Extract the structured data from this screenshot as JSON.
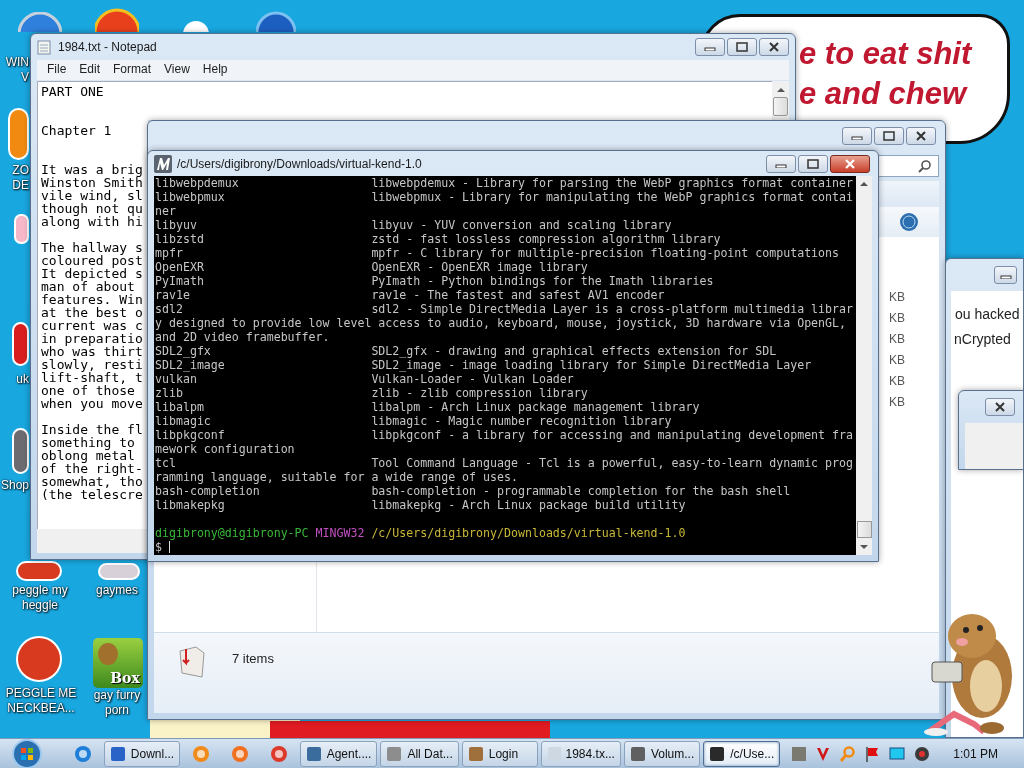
{
  "desktop_icons": [
    {
      "lines": [
        "WIN",
        "V"
      ]
    },
    {
      "lines": [
        "ZO",
        "DE"
      ]
    },
    {
      "lines": [
        "uk"
      ]
    },
    {
      "lines": [
        "Shop"
      ]
    },
    {
      "lines": [
        "peggle my",
        "heggle"
      ]
    },
    {
      "lines": [
        "PEGGLE ME",
        "NECKBEA..."
      ]
    },
    {
      "lines": [
        "gaymes"
      ]
    },
    {
      "lines": [
        "gay furry",
        "porn"
      ],
      "badge": "Box"
    }
  ],
  "speech_bubble": {
    "lines": [
      "e to eat shit",
      "e and chew"
    ]
  },
  "notepad": {
    "title": "1984.txt - Notepad",
    "menu": [
      "File",
      "Edit",
      "Format",
      "View",
      "Help"
    ],
    "lines": [
      {
        "kind": "text",
        "text": "PART ONE"
      },
      {
        "kind": "blank"
      },
      {
        "kind": "blank"
      },
      {
        "kind": "text",
        "text": "Chapter 1"
      },
      {
        "kind": "blank"
      },
      {
        "kind": "blank"
      },
      {
        "kind": "text",
        "text": "It was a brig"
      },
      {
        "kind": "text",
        "text": "Winston Smith"
      },
      {
        "kind": "text",
        "text": "vile wind, sl"
      },
      {
        "kind": "text",
        "text": "though not qu"
      },
      {
        "kind": "text",
        "text": "along with hi"
      },
      {
        "kind": "blank"
      },
      {
        "kind": "text",
        "text": "The hallway s"
      },
      {
        "kind": "text",
        "text": "coloured post"
      },
      {
        "kind": "text",
        "text": "It depicted s"
      },
      {
        "kind": "text",
        "text": "man of about"
      },
      {
        "kind": "text",
        "text": "features. Win"
      },
      {
        "kind": "text",
        "text": "at the best o"
      },
      {
        "kind": "text",
        "text": "current was c"
      },
      {
        "kind": "text",
        "text": "in preparatio"
      },
      {
        "kind": "text",
        "text": "who was thirt"
      },
      {
        "kind": "text",
        "text": "slowly, resti"
      },
      {
        "kind": "text",
        "text": "lift-shaft, t"
      },
      {
        "kind": "text",
        "text": "one of those"
      },
      {
        "kind": "text",
        "text": "when you move"
      },
      {
        "kind": "blank"
      },
      {
        "kind": "text",
        "text": "Inside the fl"
      },
      {
        "kind": "text",
        "text": "something to"
      },
      {
        "kind": "text",
        "text": "oblong metal"
      },
      {
        "kind": "text",
        "text": "of the right-"
      },
      {
        "kind": "text",
        "text": "somewhat, tho"
      },
      {
        "kind": "text",
        "text": "(the telescre"
      }
    ]
  },
  "explorer": {
    "sizes": [
      "KB",
      "KB",
      "KB",
      "KB",
      "KB",
      "KB"
    ],
    "status": "7 items"
  },
  "side_window": {
    "lines": [
      "ou hacked",
      "nCrypted"
    ]
  },
  "terminal": {
    "title": "/c/Users/digibrony/Downloads/virtual-kend-1.0",
    "lines": [
      {
        "kind": "entry",
        "name": "libwebpdemux",
        "desc": "libwebpdemux - Library for parsing the WebP graphics format container"
      },
      {
        "kind": "entry",
        "name": "libwebpmux",
        "desc": "libwebpmux - Library for manipulating the WebP graphics format contai"
      },
      {
        "kind": "wrap",
        "text": "ner"
      },
      {
        "kind": "entry",
        "name": "libyuv",
        "desc": "libyuv - YUV conversion and scaling library"
      },
      {
        "kind": "entry",
        "name": "libzstd",
        "desc": "zstd - fast lossless compression algorithm library"
      },
      {
        "kind": "entry",
        "name": "mpfr",
        "desc": "mpfr - C library for multiple-precision floating-point computations"
      },
      {
        "kind": "entry",
        "name": "OpenEXR",
        "desc": "OpenEXR - OpenEXR image library"
      },
      {
        "kind": "entry",
        "name": "PyImath",
        "desc": "PyImath - Python bindings for the Imath libraries"
      },
      {
        "kind": "entry",
        "name": "rav1e",
        "desc": "rav1e - The fastest and safest AV1 encoder"
      },
      {
        "kind": "entry",
        "name": "sdl2",
        "desc": "sdl2 - Simple DirectMedia Layer is a cross-platform multimedia librar"
      },
      {
        "kind": "wrap",
        "text": "y designed to provide low level access to audio, keyboard, mouse, joystick, 3D hardware via OpenGL,"
      },
      {
        "kind": "wrap",
        "text": "and 2D video framebuffer."
      },
      {
        "kind": "entry",
        "name": "SDL2_gfx",
        "desc": "SDL2_gfx - drawing and graphical effects extension for SDL"
      },
      {
        "kind": "entry",
        "name": "SDL2_image",
        "desc": "SDL2_image - image loading library for Simple DirectMedia Layer"
      },
      {
        "kind": "entry",
        "name": "vulkan",
        "desc": "Vulkan-Loader - Vulkan Loader"
      },
      {
        "kind": "entry",
        "name": "zlib",
        "desc": "zlib - zlib compression library"
      },
      {
        "kind": "entry",
        "name": "libalpm",
        "desc": "libalpm - Arch Linux package management library"
      },
      {
        "kind": "entry",
        "name": "libmagic",
        "desc": "libmagic - Magic number recognition library"
      },
      {
        "kind": "entry",
        "name": "libpkgconf",
        "desc": "libpkgconf - a library for accessing and manipulating development fra"
      },
      {
        "kind": "wrap",
        "text": "mework configuration"
      },
      {
        "kind": "entry",
        "name": "tcl",
        "desc": "Tool Command Language - Tcl is a powerful, easy-to-learn dynamic prog"
      },
      {
        "kind": "wrap",
        "text": "ramming language, suitable for a wide range of uses."
      },
      {
        "kind": "entry",
        "name": "bash-completion",
        "desc": "bash-completion - programmable completion for the bash shell"
      },
      {
        "kind": "entry",
        "name": "libmakepkg",
        "desc": "libmakepkg - Arch Linux package build utility"
      },
      {
        "kind": "blank"
      },
      {
        "kind": "prompt",
        "user": "digibrony@digibrony-PC",
        "system": "MINGW32",
        "path": "/c/Users/digibrony/Downloads/virtual-kend-1.0"
      },
      {
        "kind": "input",
        "text": "$"
      }
    ]
  },
  "taskbar": {
    "items": [
      {
        "kind": "pinned"
      },
      {
        "kind": "window",
        "label": "Downl...",
        "selected": false
      },
      {
        "kind": "pinned"
      },
      {
        "kind": "pinned"
      },
      {
        "kind": "pinned"
      },
      {
        "kind": "window",
        "label": "Agent....",
        "selected": false
      },
      {
        "kind": "window",
        "label": "All Dat...",
        "selected": false
      },
      {
        "kind": "window",
        "label": "Login",
        "selected": false
      },
      {
        "kind": "window",
        "label": "1984.tx...",
        "selected": false
      },
      {
        "kind": "window",
        "label": "Volum...",
        "selected": false
      },
      {
        "kind": "window",
        "label": "/c/Use...",
        "selected": true
      }
    ],
    "clock": "1:01 PM"
  }
}
